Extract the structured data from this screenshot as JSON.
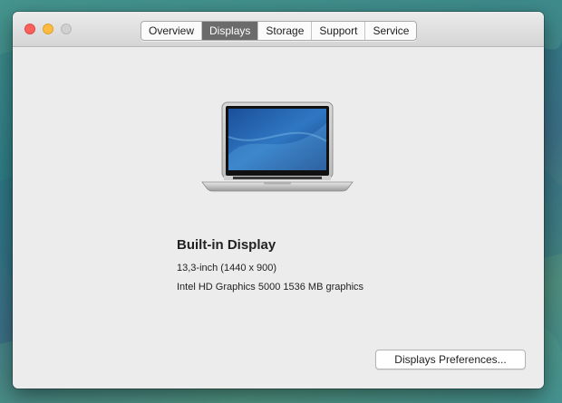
{
  "tabs": [
    {
      "label": "Overview",
      "active": false
    },
    {
      "label": "Displays",
      "active": true
    },
    {
      "label": "Storage",
      "active": false
    },
    {
      "label": "Support",
      "active": false
    },
    {
      "label": "Service",
      "active": false
    }
  ],
  "display": {
    "name": "Built-in Display",
    "size_resolution": "13,3-inch (1440 x 900)",
    "graphics": "Intel HD Graphics 5000 1536 MB graphics"
  },
  "buttons": {
    "preferences_label": "Displays Preferences..."
  },
  "icons": {
    "device": "macbook-air-icon"
  },
  "colors": {
    "active_tab": "#6b6b6b",
    "close": "#fc605c",
    "minimize": "#fdbc40",
    "zoom_disabled": "#d0d0d0"
  }
}
